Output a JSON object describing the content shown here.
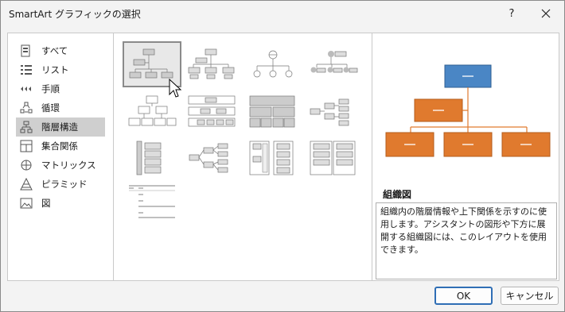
{
  "window": {
    "title": "SmartArt グラフィックの選択",
    "help": "?",
    "close": "✕"
  },
  "categories": [
    {
      "label": "すべて",
      "icon": "all-icon"
    },
    {
      "label": "リスト",
      "icon": "list-icon"
    },
    {
      "label": "手順",
      "icon": "process-icon"
    },
    {
      "label": "循環",
      "icon": "cycle-icon"
    },
    {
      "label": "階層構造",
      "icon": "hierarchy-icon",
      "selected": true
    },
    {
      "label": "集合関係",
      "icon": "relationship-icon"
    },
    {
      "label": "マトリックス",
      "icon": "matrix-icon"
    },
    {
      "label": "ピラミッド",
      "icon": "pyramid-icon"
    },
    {
      "label": "図",
      "icon": "picture-icon"
    }
  ],
  "description": {
    "title": "組織図",
    "text": "組織内の階層情報や上下関係を示すのに使用します。アシスタントの図形や下方に展開する組織図には、このレイアウトを使用できます。"
  },
  "buttons": {
    "ok": "OK",
    "cancel": "キャンセル"
  },
  "colors": {
    "accent_blue": "#4a86c5",
    "accent_orange": "#e07a2e",
    "selection": "#cfcfcf"
  }
}
